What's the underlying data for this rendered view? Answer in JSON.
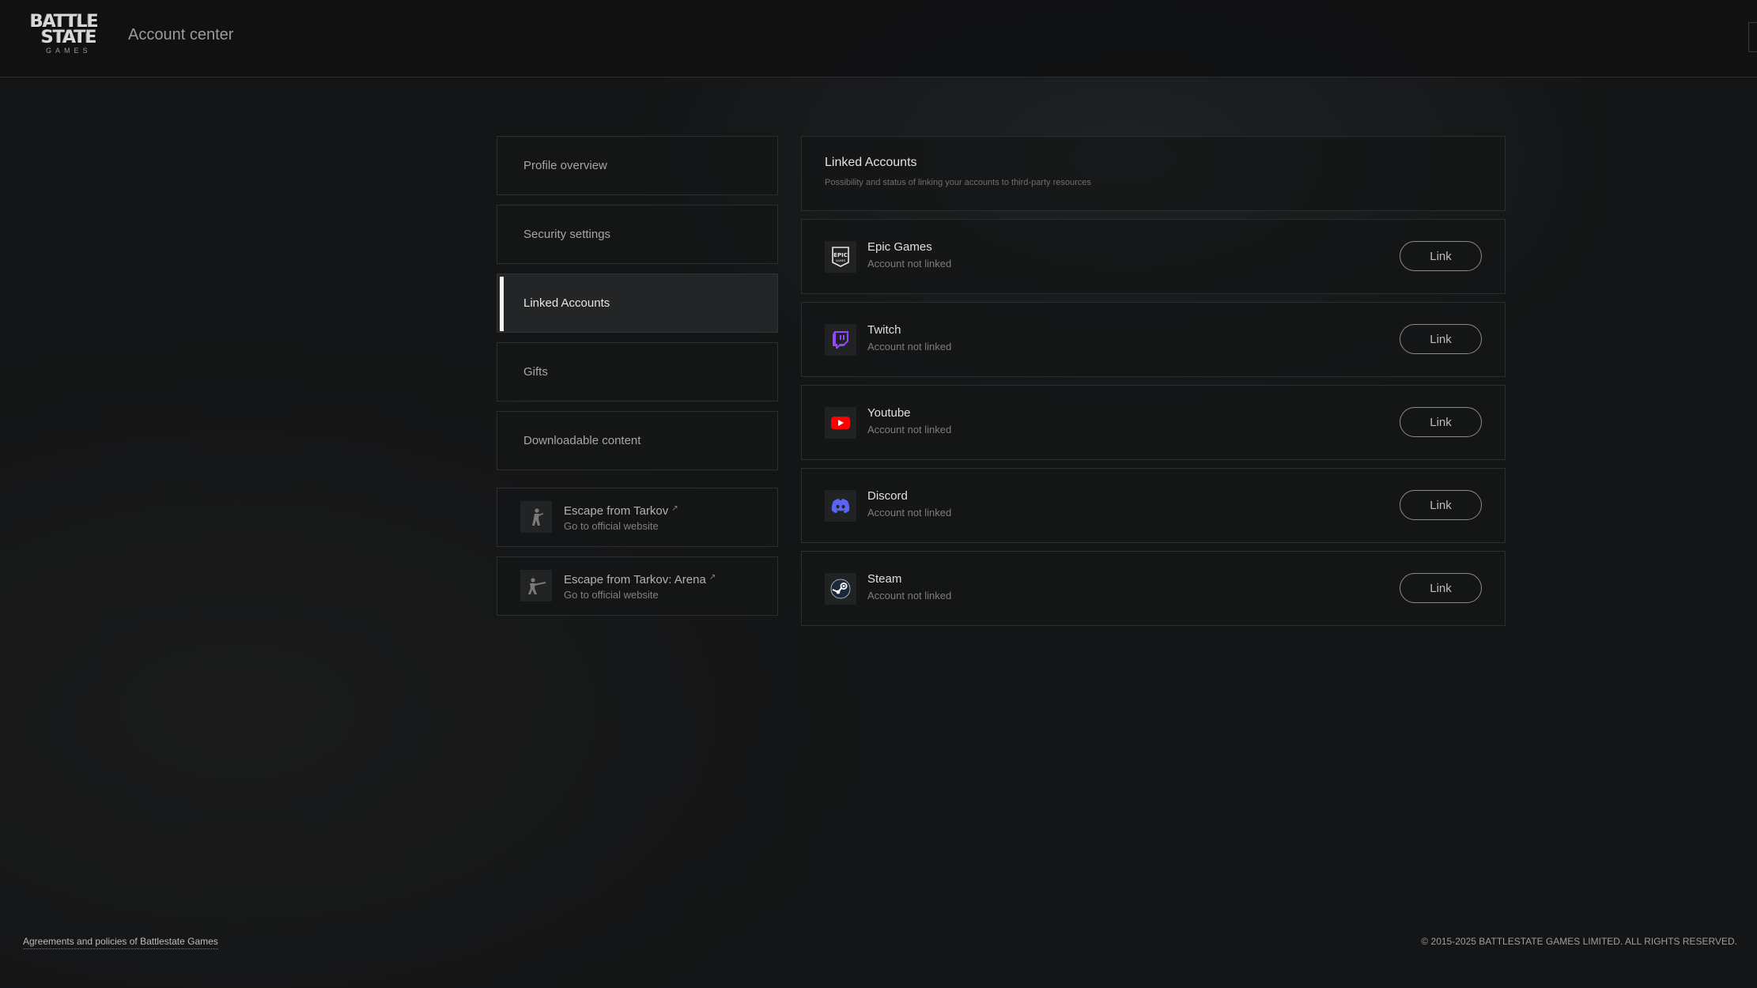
{
  "header": {
    "logo": {
      "line1": "BATTLE",
      "line2": "STATE",
      "line3": "GAMES"
    },
    "title": "Account center"
  },
  "sidebar": {
    "items": [
      {
        "label": "Profile overview"
      },
      {
        "label": "Security settings"
      },
      {
        "label": "Linked Accounts",
        "active": true
      },
      {
        "label": "Gifts"
      },
      {
        "label": "Downloadable content"
      }
    ],
    "external": [
      {
        "title": "Escape from Tarkov",
        "subtitle": "Go to official website",
        "icon": "soldier-icon"
      },
      {
        "title": "Escape from Tarkov: Arena",
        "subtitle": "Go to official website",
        "icon": "soldier-aiming-icon"
      }
    ]
  },
  "main": {
    "title": "Linked Accounts",
    "subtitle": "Possibility and status of linking your accounts to third-party resources",
    "accounts": [
      {
        "name": "Epic Games",
        "status": "Account not linked",
        "button": "Link",
        "icon": "epic-games-icon",
        "color": "#ffffff"
      },
      {
        "name": "Twitch",
        "status": "Account not linked",
        "button": "Link",
        "icon": "twitch-icon",
        "color": "#9146ff"
      },
      {
        "name": "Youtube",
        "status": "Account not linked",
        "button": "Link",
        "icon": "youtube-icon",
        "color": "#ff0000"
      },
      {
        "name": "Discord",
        "status": "Account not linked",
        "button": "Link",
        "icon": "discord-icon",
        "color": "#5865f2"
      },
      {
        "name": "Steam",
        "status": "Account not linked",
        "button": "Link",
        "icon": "steam-icon",
        "color": "#ffffff"
      }
    ]
  },
  "footer": {
    "agreements": "Agreements and policies of Battlestate Games",
    "copyright": "© 2015-2025 BATTLESTATE GAMES LIMITED. ALL RIGHTS RESERVED."
  }
}
